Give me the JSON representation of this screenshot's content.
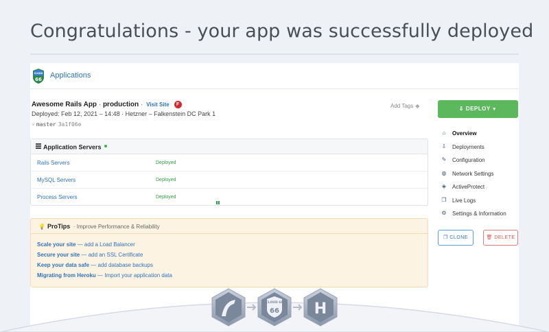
{
  "headline": "Congratulations - your app was successfully deployed",
  "topbar": {
    "apps_label": "Applications",
    "logo_text": "CLOUD 66"
  },
  "app": {
    "name": "Awesome Rails App",
    "separator": "·",
    "environment": "production",
    "visit_label": "Visit Site",
    "badge": "F",
    "deployed": "Deployed: Feb 12, 2021 – 14:48  ·  Hetzner – Falkenstein DC Park 1",
    "branch": "master",
    "commit": "3a1f06e",
    "add_tags_label": "Add Tags"
  },
  "servers": {
    "title": "Application Servers",
    "rows": [
      {
        "name": "Rails Servers",
        "status": "Deployed"
      },
      {
        "name": "MySQL Servers",
        "status": "Deployed"
      },
      {
        "name": "Process Servers",
        "status": "Deployed"
      }
    ]
  },
  "protips": {
    "title": "ProTips",
    "subtitle": "·  Improve Performance & Reliability",
    "tips": [
      {
        "lead": "Scale your site",
        "rest": " — add a Load Balancer"
      },
      {
        "lead": "Secure your site",
        "rest": " — add an SSL Certificate"
      },
      {
        "lead": "Keep your data safe",
        "rest": " — add database backups"
      },
      {
        "lead": "Migrating from Heroku",
        "rest": " — Import your application data"
      }
    ]
  },
  "actions": {
    "deploy_label": "DEPLOY",
    "clone_label": "CLONE",
    "delete_label": "DELETE"
  },
  "nav": [
    {
      "label": "Overview",
      "icon": "home-icon",
      "glyph": "⌂",
      "active": true
    },
    {
      "label": "Deployments",
      "icon": "deploy-icon",
      "glyph": "⇩"
    },
    {
      "label": "Configuration",
      "icon": "wrench-icon",
      "glyph": "✎"
    },
    {
      "label": "Network Settings",
      "icon": "globe-icon",
      "glyph": "◍"
    },
    {
      "label": "ActiveProtect",
      "icon": "shield-icon",
      "glyph": "◈"
    },
    {
      "label": "Live Logs",
      "icon": "logs-icon",
      "glyph": "❐"
    },
    {
      "label": "Settings & Information",
      "icon": "gear-icon",
      "glyph": "⚙"
    }
  ],
  "badges": {
    "middle_text": "CLOUD 66",
    "right_text": "H"
  },
  "colors": {
    "accent": "#2d73c4",
    "deploy": "#5cb85c",
    "danger": "#d9534f",
    "success": "#2f9e44"
  }
}
